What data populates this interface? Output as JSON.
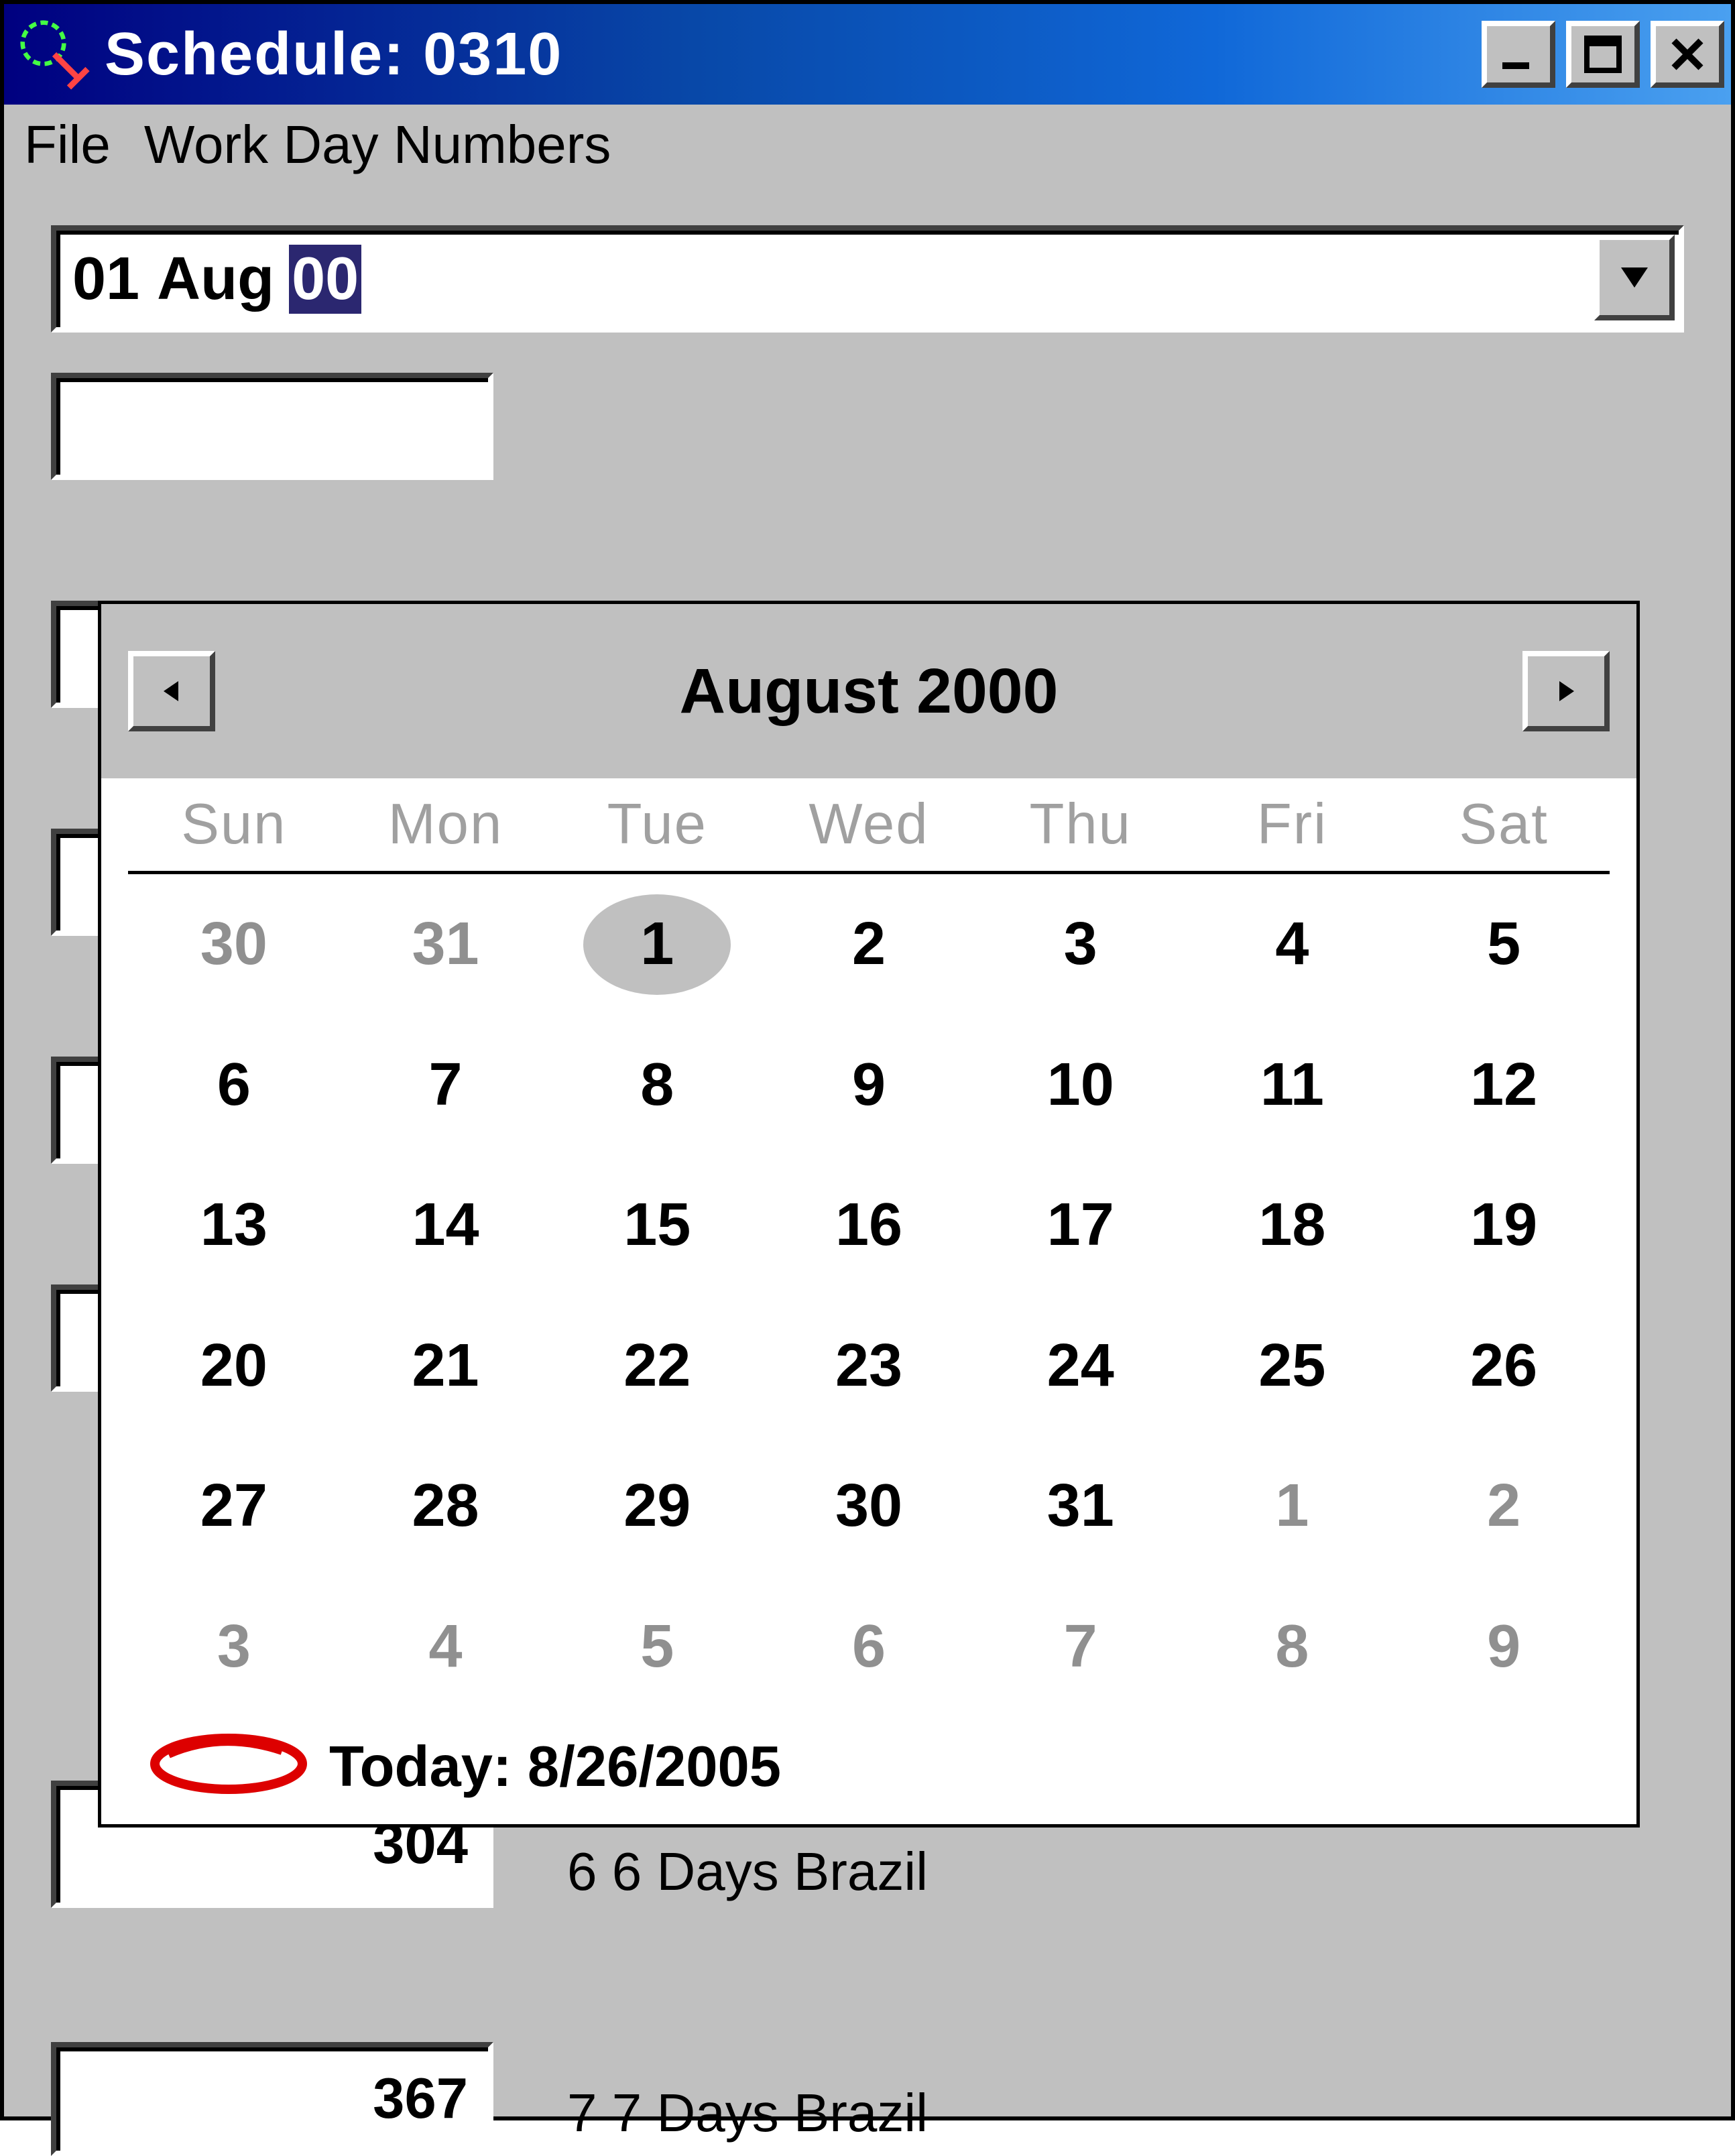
{
  "window": {
    "title": "Schedule: 0310"
  },
  "menu": {
    "file": "File",
    "workday": "Work Day Numbers"
  },
  "date_field": {
    "day": "01",
    "month": "Aug",
    "year": "00"
  },
  "rows": [
    {
      "value": "304",
      "label": "6 6 Days Brazil"
    },
    {
      "value": "367",
      "label": "7 7 Days Brazil"
    }
  ],
  "calendar": {
    "header": "August 2000",
    "dow": [
      "Sun",
      "Mon",
      "Tue",
      "Wed",
      "Thu",
      "Fri",
      "Sat"
    ],
    "weeks": [
      [
        {
          "d": "30",
          "o": true
        },
        {
          "d": "31",
          "o": true
        },
        {
          "d": "1",
          "sel": true
        },
        {
          "d": "2"
        },
        {
          "d": "3"
        },
        {
          "d": "4"
        },
        {
          "d": "5"
        }
      ],
      [
        {
          "d": "6"
        },
        {
          "d": "7"
        },
        {
          "d": "8"
        },
        {
          "d": "9"
        },
        {
          "d": "10"
        },
        {
          "d": "11"
        },
        {
          "d": "12"
        }
      ],
      [
        {
          "d": "13"
        },
        {
          "d": "14"
        },
        {
          "d": "15"
        },
        {
          "d": "16"
        },
        {
          "d": "17"
        },
        {
          "d": "18"
        },
        {
          "d": "19"
        }
      ],
      [
        {
          "d": "20"
        },
        {
          "d": "21"
        },
        {
          "d": "22"
        },
        {
          "d": "23"
        },
        {
          "d": "24"
        },
        {
          "d": "25"
        },
        {
          "d": "26"
        }
      ],
      [
        {
          "d": "27"
        },
        {
          "d": "28"
        },
        {
          "d": "29"
        },
        {
          "d": "30"
        },
        {
          "d": "31"
        },
        {
          "d": "1",
          "o": true
        },
        {
          "d": "2",
          "o": true
        }
      ],
      [
        {
          "d": "3",
          "o": true
        },
        {
          "d": "4",
          "o": true
        },
        {
          "d": "5",
          "o": true
        },
        {
          "d": "6",
          "o": true
        },
        {
          "d": "7",
          "o": true
        },
        {
          "d": "8",
          "o": true
        },
        {
          "d": "9",
          "o": true
        }
      ]
    ],
    "today_label": "Today: 8/26/2005"
  }
}
